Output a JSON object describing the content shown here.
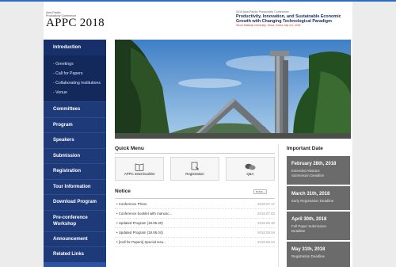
{
  "header": {
    "org_line1": "Asia-Pacific",
    "org_line2": "Productivity Conference",
    "logo": "APPC 2018",
    "conf_line": "2018 Asia-Pacific Productivity Conference",
    "title_line1": "Productivity, Innovation, and Sustainable Economic",
    "title_line2": "Growth with Changing Technological Paradigm",
    "venue": "Seoul National University, Seoul, Korea July 4-6, 2018"
  },
  "sidebar": {
    "top": "Introduction",
    "sub_items": [
      "- Greetings",
      "- Call for Papers",
      "- Collaborating Institutions",
      "- Venue"
    ],
    "items": [
      "Committees",
      "Program",
      "Speakers",
      "Submission",
      "Registration",
      "Tour Information",
      "Download Program"
    ],
    "item_pre1": "Pre-conference",
    "item_pre2": "Workshop",
    "items2": [
      "Announcement",
      "Related Links"
    ]
  },
  "quick_menu": {
    "title": "Quick Menu",
    "buttons": [
      {
        "label": "APPC 2018 booklet",
        "icon": "book-icon"
      },
      {
        "label": "Registration",
        "icon": "registration-icon"
      },
      {
        "label": "Q&A",
        "icon": "chat-icon"
      }
    ]
  },
  "notice": {
    "title": "Notice",
    "more": "MORE +",
    "rows": [
      {
        "title": "Conference Photo",
        "date": "2018.07.17"
      },
      {
        "title": "Conference booklet with manusc...",
        "date": "2018.07.02"
      },
      {
        "title": "Updated Program (18.06.30)",
        "date": "2018.06.30"
      },
      {
        "title": "Updated Program (18.06.04)",
        "date": "2018.06.04"
      },
      {
        "title": "[Call for Papers] Special Issu...",
        "date": "2018.06.04"
      }
    ]
  },
  "important_date": {
    "title": "Important Date",
    "cards": [
      {
        "date": "February 28th, 2018",
        "label1": "Extended Abstract",
        "label2": "Submission Deadline"
      },
      {
        "date": "March 31th, 2018",
        "label1": "Early Registration Deadline",
        "label2": ""
      },
      {
        "date": "April 30th, 2018",
        "label1": "Full Paper Submission",
        "label2": "Deadline"
      },
      {
        "date": "May 31th, 2018",
        "label1": "Registration Deadline",
        "label2": ""
      }
    ]
  },
  "colors": {
    "accent": "#2b6cc4",
    "sidebar": "#1e3a78",
    "date_card": "#6b6b6b"
  }
}
